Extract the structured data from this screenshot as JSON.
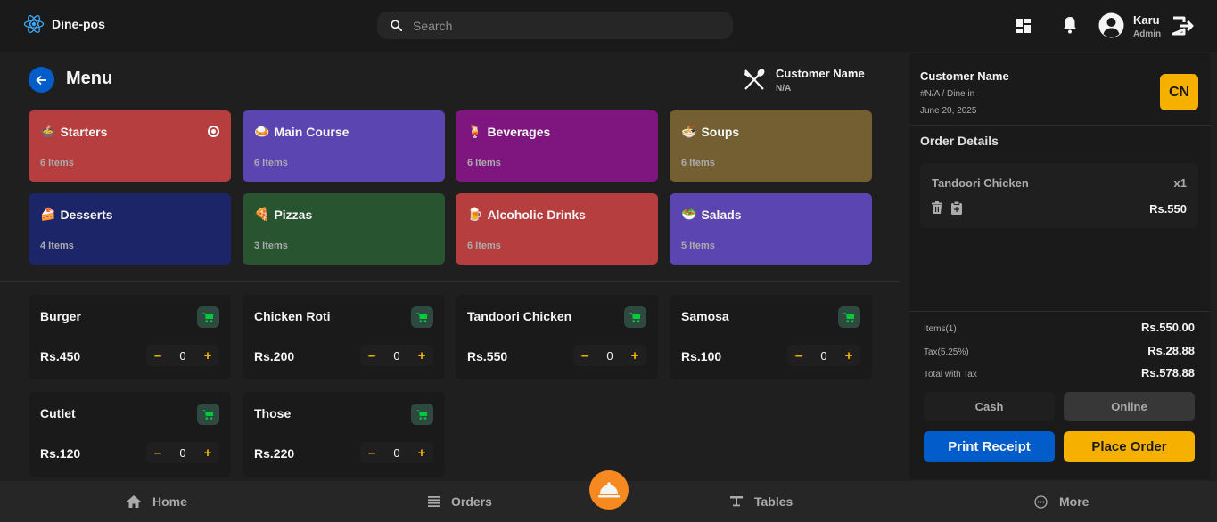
{
  "app": {
    "name": "Dine-pos"
  },
  "search": {
    "placeholder": "Search"
  },
  "user": {
    "name": "Karu",
    "role": "Admin"
  },
  "menu": {
    "title": "Menu",
    "customer_name": "Customer Name",
    "customer_sub": "N/A"
  },
  "categories": [
    {
      "emoji": "🍲",
      "name": "Starters",
      "count": "6 Items",
      "color": "#b73e3e",
      "selected": true
    },
    {
      "emoji": "🍛",
      "name": "Main Course",
      "count": "6 Items",
      "color": "#5b45b0"
    },
    {
      "emoji": "🍹",
      "name": "Beverages",
      "count": "6 Items",
      "color": "#7f167f"
    },
    {
      "emoji": "🍜",
      "name": "Soups",
      "count": "6 Items",
      "color": "#735f32"
    },
    {
      "emoji": "🍰",
      "name": "Desserts",
      "count": "4 Items",
      "color": "#1d2569"
    },
    {
      "emoji": "🍕",
      "name": "Pizzas",
      "count": "3 Items",
      "color": "#285430"
    },
    {
      "emoji": "🍺",
      "name": "Alcoholic Drinks",
      "count": "6 Items",
      "color": "#b73e3e"
    },
    {
      "emoji": "🥗",
      "name": "Salads",
      "count": "5 Items",
      "color": "#5b45b0"
    }
  ],
  "items": [
    {
      "name": "Burger",
      "price": "Rs.450",
      "qty": "0"
    },
    {
      "name": "Chicken Roti",
      "price": "Rs.200",
      "qty": "0"
    },
    {
      "name": "Tandoori Chicken",
      "price": "Rs.550",
      "qty": "0"
    },
    {
      "name": "Samosa",
      "price": "Rs.100",
      "qty": "0"
    },
    {
      "name": "Cutlet",
      "price": "Rs.120",
      "qty": "0"
    },
    {
      "name": "Those",
      "price": "Rs.220",
      "qty": "0"
    }
  ],
  "stepper": {
    "minus": "–",
    "plus": "+"
  },
  "order_panel": {
    "customer_name": "Customer Name",
    "order_info": "#N/A / Dine in",
    "date": "June 20, 2025",
    "avatar": "CN",
    "details_title": "Order Details",
    "order_items": [
      {
        "name": "Tandoori Chicken",
        "qty": "x1",
        "price": "Rs.550"
      }
    ],
    "summary": [
      {
        "label": "Items(1)",
        "value": "Rs.550.00"
      },
      {
        "label": "Tax(5.25%)",
        "value": "Rs.28.88"
      },
      {
        "label": "Total with Tax",
        "value": "Rs.578.88"
      }
    ],
    "payment": {
      "cash": "Cash",
      "online": "Online"
    },
    "print_receipt": "Print Receipt",
    "place_order": "Place Order"
  },
  "bottom_nav": {
    "home": "Home",
    "orders": "Orders",
    "tables": "Tables",
    "more": "More"
  },
  "colors": {
    "accent_yellow": "#f6b100",
    "accent_blue": "#025cca",
    "fab_orange": "#f6891f",
    "cart_green": "#02ca3a"
  }
}
